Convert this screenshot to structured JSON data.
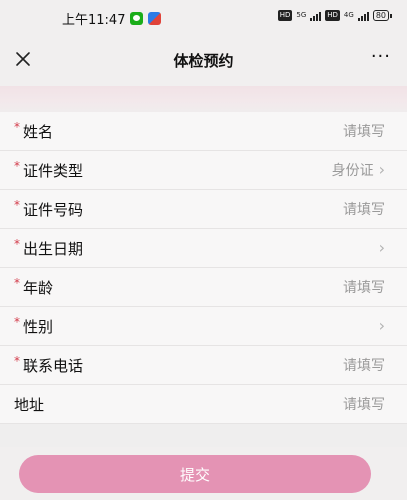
{
  "status_bar": {
    "time": "上午11:47",
    "hd1": "HD",
    "net1": "5G",
    "hd2": "HD",
    "net2": "4G",
    "battery": "80"
  },
  "nav": {
    "title": "体检预约",
    "more": "···"
  },
  "form": {
    "rows": [
      {
        "label": "姓名",
        "value": "请填写",
        "required": true,
        "chevron": false
      },
      {
        "label": "证件类型",
        "value": "身份证",
        "required": true,
        "chevron": true
      },
      {
        "label": "证件号码",
        "value": "请填写",
        "required": true,
        "chevron": false
      },
      {
        "label": "出生日期",
        "value": "",
        "required": true,
        "chevron": true
      },
      {
        "label": "年龄",
        "value": "请填写",
        "required": true,
        "chevron": false
      },
      {
        "label": "性别",
        "value": "",
        "required": true,
        "chevron": true
      },
      {
        "label": "联系电话",
        "value": "请填写",
        "required": true,
        "chevron": false
      },
      {
        "label": "地址",
        "value": "请填写",
        "required": false,
        "chevron": false
      }
    ],
    "required_mark": "*",
    "chevron_glyph": "›"
  },
  "submit": {
    "label": "提交",
    "color": "#e493b4"
  }
}
